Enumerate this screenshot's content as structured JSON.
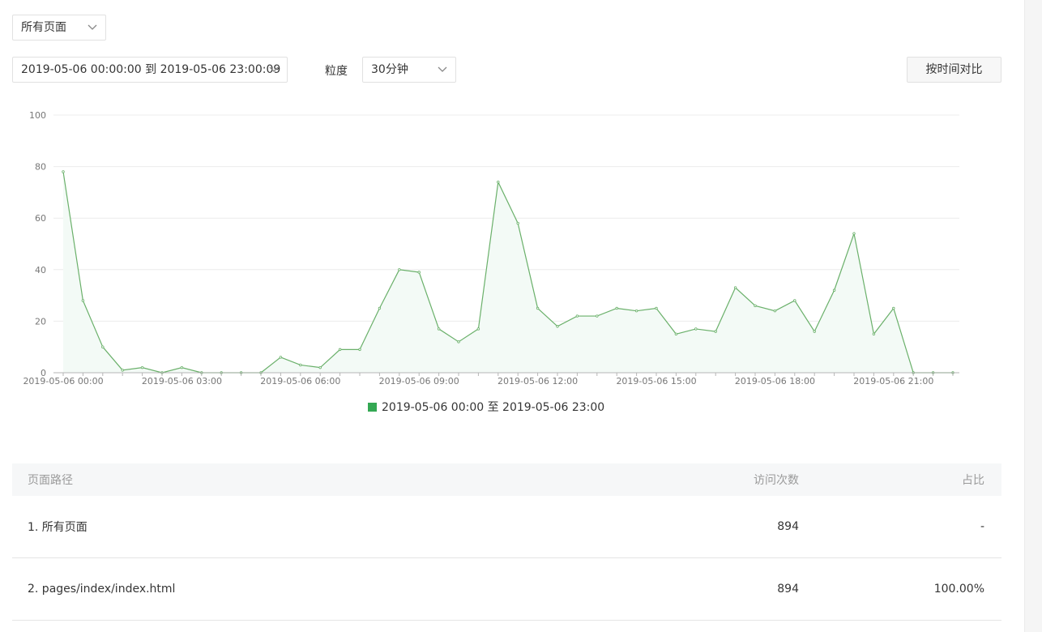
{
  "page_select": {
    "value": "所有页面",
    "icon": "chevron-down-icon"
  },
  "date_range": {
    "value": "2019-05-06 00:00:00 到 2019-05-06 23:00:09",
    "icon": "chevron-down-icon"
  },
  "granularity": {
    "label": "粒度",
    "value": "30分钟",
    "icon": "chevron-down-icon"
  },
  "compare_button": {
    "label": "按时间对比"
  },
  "colors": {
    "series": "#6ab06a",
    "legend_swatch": "#34a853",
    "area_fill": "#f3faf6",
    "grid": "#ececec"
  },
  "chart_data": {
    "type": "area",
    "y_ticks": [
      "0",
      "20",
      "40",
      "60",
      "80",
      "100"
    ],
    "ylim": [
      0,
      100
    ],
    "x_tick_labels": [
      "2019-05-06 00:00",
      "2019-05-06 03:00",
      "2019-05-06 06:00",
      "2019-05-06 09:00",
      "2019-05-06 12:00",
      "2019-05-06 15:00",
      "2019-05-06 18:00",
      "2019-05-06 21:00"
    ],
    "x_interval_minutes": 30,
    "series": [
      {
        "name": "2019-05-06 00:00 至 2019-05-06 23:00",
        "values": [
          78,
          28,
          10,
          1,
          2,
          0,
          2,
          0,
          0,
          0,
          0,
          6,
          3,
          2,
          9,
          9,
          25,
          40,
          39,
          17,
          12,
          17,
          74,
          58,
          25,
          18,
          22,
          22,
          25,
          24,
          25,
          15,
          17,
          16,
          33,
          26,
          24,
          28,
          16,
          32,
          54,
          15,
          25,
          0,
          0,
          0
        ]
      }
    ],
    "grid": true,
    "legend_position": "bottom"
  },
  "table": {
    "headers": [
      "页面路径",
      "访问次数",
      "占比"
    ],
    "rows": [
      [
        "1. 所有页面",
        "894",
        "-"
      ],
      [
        "2. pages/index/index.html",
        "894",
        "100.00%"
      ]
    ]
  }
}
